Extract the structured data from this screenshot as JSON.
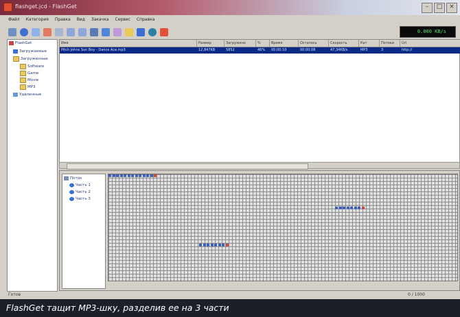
{
  "window": {
    "title": "flashget.jcd - FlashGet"
  },
  "menu": [
    "Файл",
    "Категория",
    "Правка",
    "Вид",
    "Закачка",
    "Сервис",
    "Справка"
  ],
  "toolbar": {
    "icons": [
      "new-icon",
      "open-icon",
      "save-icon",
      "delete-icon",
      "edit-icon",
      "back-icon",
      "forward-icon",
      "binoculars-icon",
      "refresh-icon",
      "connect-icon",
      "download-icon",
      "stop-icon",
      "settings-icon",
      "flashget-icon"
    ],
    "speed": "0.000 KB/s"
  },
  "left_tree": [
    "FlashGet",
    "Загружаемые",
    "Загруженные",
    "Software",
    "Game",
    "Movie",
    "MP3",
    "Удаленные"
  ],
  "list": {
    "headers": [
      "Имя",
      "Размер",
      "Загружено",
      "%",
      "Время",
      "Осталось",
      "Скорость",
      "Кат",
      "Потоки",
      "Url"
    ],
    "rows": [
      [
        "Pitch Johns Sun Boy - Dance Ace.mp3",
        "12,847KB",
        "5852",
        "46%",
        "00:00:10",
        "00:00:08",
        "47,34KB/s",
        "MP3",
        "3",
        "http://"
      ]
    ]
  },
  "threads": {
    "items": [
      "Поток",
      "Часть 1",
      "Часть 2",
      "Часть 3"
    ]
  },
  "status": {
    "left": "Готов",
    "right": "0 / 1000"
  },
  "caption": "FlashGet тащит MP3-шку, разделив ее на 3 части"
}
